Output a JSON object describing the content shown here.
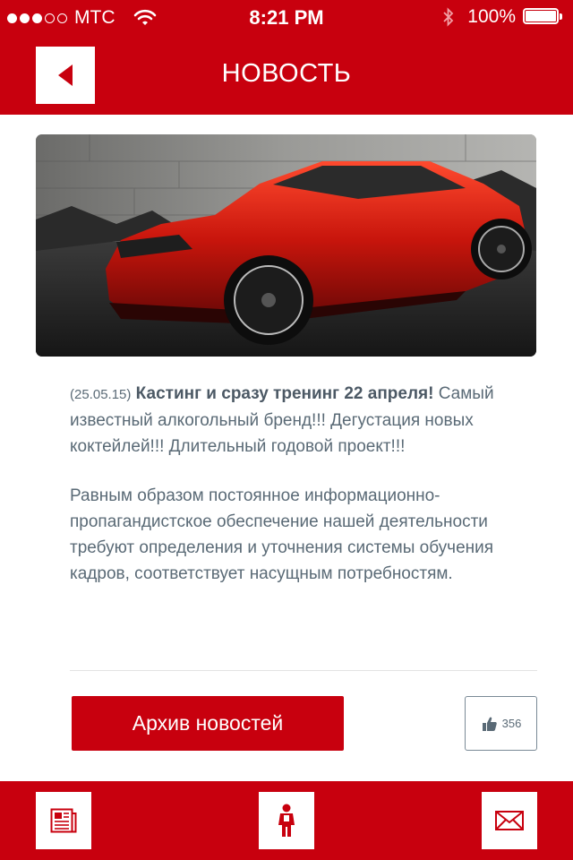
{
  "status_bar": {
    "carrier": "МТС",
    "time": "8:21 PM",
    "battery": "100%",
    "signal_bars": 3,
    "signal_total": 5
  },
  "header": {
    "title": "НОВОСТЬ",
    "back_icon": "back-arrow-icon"
  },
  "article": {
    "image": "red-sports-car-photo",
    "date": "(25.05.15)",
    "headline": "Кастинг и сразу тренинг 22 апреля!",
    "lead": "Самый известный алкогольный бренд!!! Дегустация новых коктейлей!!! Длительный годовой проект!!!",
    "body": "Равным образом постоянное информационно-пропагандистское обеспечение нашей деятельности требуют определения и уточнения системы обучения кадров, соответствует насущным потребностям."
  },
  "actions": {
    "archive_label": "Архив новостей",
    "likes": "356"
  },
  "footer": {
    "items": [
      {
        "icon": "news-icon"
      },
      {
        "icon": "person-icon"
      },
      {
        "icon": "mail-icon"
      }
    ]
  },
  "colors": {
    "accent": "#c8000e",
    "text": "#5a6a76",
    "white": "#ffffff"
  }
}
